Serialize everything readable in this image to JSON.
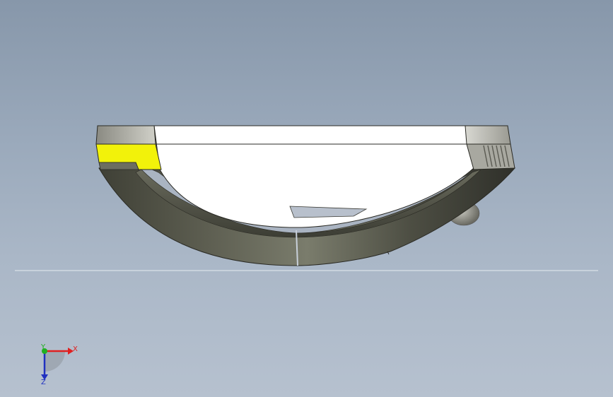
{
  "viewport": {
    "background_top": "#8797aa",
    "background_bottom": "#b6c1cf"
  },
  "model": {
    "description_colors": {
      "shell_dark": "#4e4f44",
      "shell_light": "#8a8c7c",
      "top_face": "#ffffff",
      "highlight_face": "#f2f20a",
      "edge_face": "#b8b8b0",
      "inner_rim": "#aab4c2"
    }
  },
  "triad": {
    "x_label": "X",
    "y_label": "Y",
    "z_label": "Z",
    "x_color": "#e02020",
    "y_color": "#20b020",
    "z_color": "#2030c0"
  }
}
